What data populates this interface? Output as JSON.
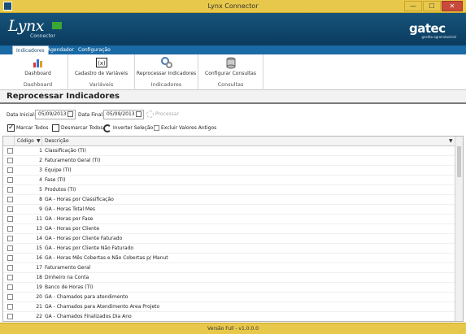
{
  "window": {
    "title": "Lynx Connector",
    "minimize": "—",
    "maximize": "☐",
    "close": "✕"
  },
  "banner": {
    "logo_main": "Lynx",
    "logo_sub": "Connector",
    "brand": "gatec",
    "brand_sub": "gestão agroindustrial"
  },
  "tabs": [
    {
      "label": "Indicadores",
      "active": true
    },
    {
      "label": "Agendador",
      "active": false
    },
    {
      "label": "Configuração",
      "active": false
    }
  ],
  "ribbon": [
    {
      "button": "Dashboard",
      "group": "Dashboard"
    },
    {
      "button": "Cadastro de Variáveis",
      "group": "Variáveis"
    },
    {
      "button": "Reprocessar Indicadores",
      "group": "Indicadores"
    },
    {
      "button": "Configurar Consultas",
      "group": "Consultas"
    }
  ],
  "page": {
    "title": "Reprocessar Indicadores"
  },
  "filters": {
    "start_label": "Data Inicial:",
    "start_value": "05/09/2013",
    "end_label": "Data Final:",
    "end_value": "05/09/2013",
    "process_label": "Processar"
  },
  "actions": {
    "mark_all": "Marcar Todos",
    "unmark_all": "Desmarcar Todos",
    "invert": "Inverter Seleção",
    "exclude_old": "Excluir Valores Antigos"
  },
  "grid": {
    "headers": {
      "code": "Código",
      "desc": "Descrição"
    },
    "rows": [
      {
        "code": "1",
        "desc": "Classificação (TI)"
      },
      {
        "code": "2",
        "desc": "Faturamento Geral (TI)"
      },
      {
        "code": "3",
        "desc": "Equipe (TI)"
      },
      {
        "code": "4",
        "desc": "Fase (TI)"
      },
      {
        "code": "5",
        "desc": "Produtos (TI)"
      },
      {
        "code": "8",
        "desc": "GA - Horas por Classificação"
      },
      {
        "code": "9",
        "desc": "GA - Horas Total Mes"
      },
      {
        "code": "11",
        "desc": "GA - Horas por Fase"
      },
      {
        "code": "13",
        "desc": "GA - Horas por Cliente"
      },
      {
        "code": "14",
        "desc": "GA - Horas por Cliente Faturado"
      },
      {
        "code": "15",
        "desc": "GA - Horas por Cliente Não Faturado"
      },
      {
        "code": "16",
        "desc": "GA - Horas Mês Cobertas e Não Cobertas p/ Manut"
      },
      {
        "code": "17",
        "desc": "Faturamento Geral"
      },
      {
        "code": "18",
        "desc": "Dinheiro na Conta"
      },
      {
        "code": "19",
        "desc": "Banco de Horas (TI)"
      },
      {
        "code": "20",
        "desc": "GA - Chamados para atendimento"
      },
      {
        "code": "21",
        "desc": "GA - Chamados para Atendimento Area Projeto"
      },
      {
        "code": "22",
        "desc": "GA - Chamados Finalizados Dia Ano"
      }
    ]
  },
  "status": {
    "version": "Versão Full - v1.0.0.0"
  },
  "colors": {
    "titlebar": "#e8c84a",
    "banner": "#16537a",
    "tabbar": "#1a6aa6"
  }
}
